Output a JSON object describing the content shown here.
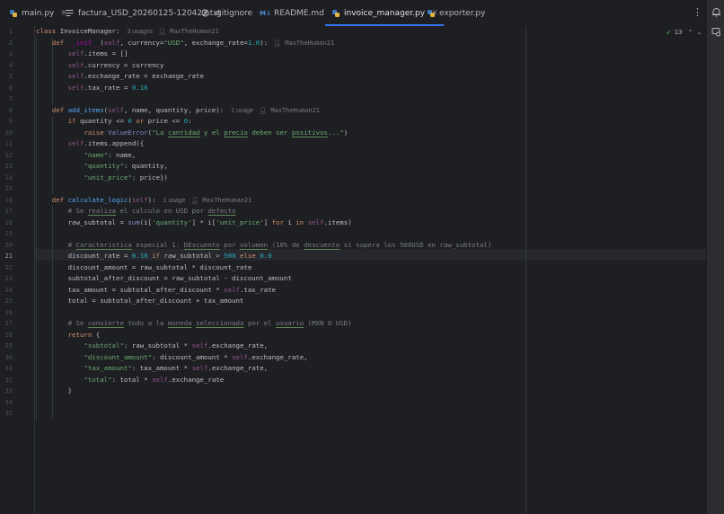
{
  "tabs": [
    {
      "label": "main.py",
      "icon": "python-icon",
      "active": false,
      "closable": true
    },
    {
      "label": "factura_USD_20260125-120423.txt",
      "icon": "text-file-icon",
      "active": false,
      "closable": false
    },
    {
      "label": ".gitignore",
      "icon": "gitignore-icon",
      "active": false,
      "closable": false
    },
    {
      "label": "README.md",
      "icon": "markdown-icon",
      "active": false,
      "closable": false
    },
    {
      "label": "invoice_manager.py",
      "icon": "python-icon",
      "active": true,
      "closable": true
    },
    {
      "label": "exporter.py",
      "icon": "python-icon",
      "active": false,
      "closable": false
    }
  ],
  "inspection": {
    "count": "13",
    "status_icon": "check-icon"
  },
  "colors": {
    "accent": "#3574f0",
    "background": "#1e1f22",
    "keyword": "#cf8e6d",
    "function": "#56a8f5",
    "string": "#6aab73",
    "number": "#2aacb8",
    "comment": "#7a7e85",
    "self": "#94558d"
  },
  "editor": {
    "current_line": 21,
    "line_numbers": [
      "1",
      "2",
      "3",
      "4",
      "5",
      "6",
      "7",
      "8",
      "9",
      "10",
      "11",
      "12",
      "13",
      "14",
      "15",
      "16",
      "17",
      "18",
      "19",
      "20",
      "21",
      "22",
      "23",
      "24",
      "25",
      "26",
      "27",
      "28",
      "29",
      "30",
      "31",
      "32",
      "33",
      "34",
      "35"
    ],
    "code_lines": [
      [
        {
          "t": "class ",
          "c": "kw"
        },
        {
          "t": "InvoiceManager:"
        },
        {
          "t": "3 usages",
          "c": "hint"
        },
        {
          "t": "MaxTheHuman21",
          "c": "person"
        }
      ],
      [
        {
          "t": "    def ",
          "c": "kw"
        },
        {
          "t": "__init__",
          "c": "dn"
        },
        {
          "t": "("
        },
        {
          "t": "self",
          "c": "sf"
        },
        {
          "t": ", currency="
        },
        {
          "t": "\"USD\"",
          "c": "st"
        },
        {
          "t": ", exchange_rate="
        },
        {
          "t": "1.0",
          "c": "nm"
        },
        {
          "t": "):"
        },
        {
          "t": "MaxTheHuman21",
          "c": "person"
        }
      ],
      [
        {
          "t": "        "
        },
        {
          "t": "self",
          "c": "sf"
        },
        {
          "t": ".items = []"
        }
      ],
      [
        {
          "t": "        "
        },
        {
          "t": "self",
          "c": "sf"
        },
        {
          "t": ".currency = currency"
        }
      ],
      [
        {
          "t": "        "
        },
        {
          "t": "self",
          "c": "sf"
        },
        {
          "t": ".exchange_rate = exchange_rate"
        }
      ],
      [
        {
          "t": "        "
        },
        {
          "t": "self",
          "c": "sf"
        },
        {
          "t": ".tax_rate = "
        },
        {
          "t": "0.16",
          "c": "nm"
        }
      ],
      [],
      [
        {
          "t": "    def ",
          "c": "kw"
        },
        {
          "t": "add_items",
          "c": "fn"
        },
        {
          "t": "("
        },
        {
          "t": "self",
          "c": "sf"
        },
        {
          "t": ", name, quantity, price):"
        },
        {
          "t": "1 usage",
          "c": "hint"
        },
        {
          "t": "MaxTheHuman21",
          "c": "person"
        }
      ],
      [
        {
          "t": "        "
        },
        {
          "t": "if ",
          "c": "kw"
        },
        {
          "t": "quantity <= "
        },
        {
          "t": "0",
          "c": "nm"
        },
        {
          "t": " or ",
          "c": "kw"
        },
        {
          "t": "price <= "
        },
        {
          "t": "0",
          "c": "nm"
        },
        {
          "t": ":"
        }
      ],
      [
        {
          "t": "            "
        },
        {
          "t": "raise ",
          "c": "kw"
        },
        {
          "t": "ValueError",
          "c": "bi"
        },
        {
          "t": "("
        },
        {
          "t": "\"La ",
          "c": "st"
        },
        {
          "t": "cantidad",
          "c": "st ty"
        },
        {
          "t": " y el ",
          "c": "st"
        },
        {
          "t": "precio",
          "c": "st ty"
        },
        {
          "t": " deben ser ",
          "c": "st"
        },
        {
          "t": "positivos",
          "c": "st ty"
        },
        {
          "t": "...\"",
          "c": "st"
        },
        {
          "t": ")"
        }
      ],
      [
        {
          "t": "        "
        },
        {
          "t": "self",
          "c": "sf"
        },
        {
          "t": ".items.append({"
        }
      ],
      [
        {
          "t": "            "
        },
        {
          "t": "\"name\"",
          "c": "st"
        },
        {
          "t": ": name,"
        }
      ],
      [
        {
          "t": "            "
        },
        {
          "t": "\"quantity\"",
          "c": "st"
        },
        {
          "t": ": quantity,"
        }
      ],
      [
        {
          "t": "            "
        },
        {
          "t": "\"unit_price\"",
          "c": "st"
        },
        {
          "t": ": price})"
        }
      ],
      [],
      [
        {
          "t": "    def ",
          "c": "kw"
        },
        {
          "t": "calculate_logic",
          "c": "fn"
        },
        {
          "t": "("
        },
        {
          "t": "self",
          "c": "sf"
        },
        {
          "t": "):"
        },
        {
          "t": "1 usage",
          "c": "hint"
        },
        {
          "t": "MaxTheHuman21",
          "c": "person"
        }
      ],
      [
        {
          "t": "        "
        },
        {
          "t": "# Se ",
          "c": "cm"
        },
        {
          "t": "realiza",
          "c": "cm ty"
        },
        {
          "t": " el calculo en USD por ",
          "c": "cm"
        },
        {
          "t": "defecto",
          "c": "cm ty"
        }
      ],
      [
        {
          "t": "        raw_subtotal = "
        },
        {
          "t": "sum",
          "c": "bi"
        },
        {
          "t": "(i["
        },
        {
          "t": "'quantity'",
          "c": "st"
        },
        {
          "t": "] * i["
        },
        {
          "t": "'unit_price'",
          "c": "st"
        },
        {
          "t": "] "
        },
        {
          "t": "for ",
          "c": "kw"
        },
        {
          "t": "i "
        },
        {
          "t": "in ",
          "c": "kw"
        },
        {
          "t": "self",
          "c": "sf"
        },
        {
          "t": ".items)"
        }
      ],
      [],
      [
        {
          "t": "        "
        },
        {
          "t": "# ",
          "c": "cm"
        },
        {
          "t": "Caracteristica",
          "c": "cm ty"
        },
        {
          "t": " especial 1: ",
          "c": "cm"
        },
        {
          "t": "DEscuento",
          "c": "cm ty"
        },
        {
          "t": " por ",
          "c": "cm"
        },
        {
          "t": "volumen",
          "c": "cm ty"
        },
        {
          "t": " (10% de ",
          "c": "cm"
        },
        {
          "t": "descuento",
          "c": "cm ty"
        },
        {
          "t": " si supera los 500USD en raw_subtotal)",
          "c": "cm"
        }
      ],
      [
        {
          "t": "        discount_rate = "
        },
        {
          "t": "0.10",
          "c": "nm"
        },
        {
          "t": " if ",
          "c": "kw"
        },
        {
          "t": "raw_subtotal > "
        },
        {
          "t": "500",
          "c": "nm"
        },
        {
          "t": " else ",
          "c": "kw"
        },
        {
          "t": "0.0",
          "c": "nm"
        }
      ],
      [
        {
          "t": "        discount_amount = raw_subtotal * discount_rate"
        }
      ],
      [
        {
          "t": "        subtotal_after_discount = raw_subtotal - discount_amount"
        }
      ],
      [
        {
          "t": "        tax_amount = subtotal_after_discount * "
        },
        {
          "t": "self",
          "c": "sf"
        },
        {
          "t": ".tax_rate"
        }
      ],
      [
        {
          "t": "        total = subtotal_after_discount + tax_amount"
        }
      ],
      [],
      [
        {
          "t": "        "
        },
        {
          "t": "# Se ",
          "c": "cm"
        },
        {
          "t": "convierte",
          "c": "cm ty"
        },
        {
          "t": " todo a la ",
          "c": "cm"
        },
        {
          "t": "moneda",
          "c": "cm ty"
        },
        {
          "t": " ",
          "c": "cm"
        },
        {
          "t": "seleccionada",
          "c": "cm ty"
        },
        {
          "t": " por el ",
          "c": "cm"
        },
        {
          "t": "usuario",
          "c": "cm ty"
        },
        {
          "t": " (MXN O USD)",
          "c": "cm"
        }
      ],
      [
        {
          "t": "        "
        },
        {
          "t": "return ",
          "c": "kw"
        },
        {
          "t": "{"
        }
      ],
      [
        {
          "t": "            "
        },
        {
          "t": "\"subtotal\"",
          "c": "st"
        },
        {
          "t": ": raw_subtotal * "
        },
        {
          "t": "self",
          "c": "sf"
        },
        {
          "t": ".exchange_rate,"
        }
      ],
      [
        {
          "t": "            "
        },
        {
          "t": "\"discount_amount\"",
          "c": "st"
        },
        {
          "t": ": discount_amount * "
        },
        {
          "t": "self",
          "c": "sf"
        },
        {
          "t": ".exchange_rate,"
        }
      ],
      [
        {
          "t": "            "
        },
        {
          "t": "\"tax_amount\"",
          "c": "st"
        },
        {
          "t": ": tax_amount * "
        },
        {
          "t": "self",
          "c": "sf"
        },
        {
          "t": ".exchange_rate,"
        }
      ],
      [
        {
          "t": "            "
        },
        {
          "t": "\"total\"",
          "c": "st"
        },
        {
          "t": ": total * "
        },
        {
          "t": "self",
          "c": "sf"
        },
        {
          "t": ".exchange_rate"
        }
      ],
      [
        {
          "t": "        }"
        }
      ],
      [],
      []
    ]
  }
}
